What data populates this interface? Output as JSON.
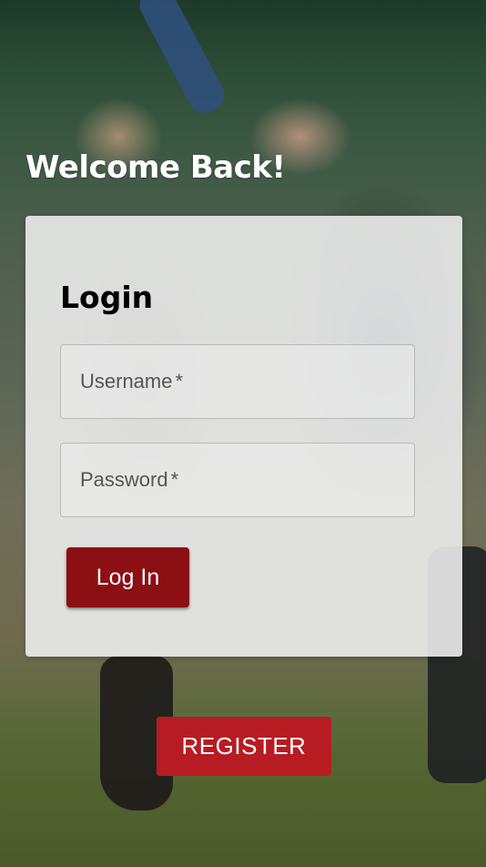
{
  "header": {
    "welcome_text": "Welcome Back!"
  },
  "login_card": {
    "title": "Login",
    "username": {
      "label": "Username",
      "required_mark": "*",
      "value": ""
    },
    "password": {
      "label": "Password",
      "required_mark": "*",
      "value": ""
    },
    "login_button_label": "Log In"
  },
  "register_button_label": "REGISTER",
  "colors": {
    "login_button": "#8c0f14",
    "register_button": "#b71c23",
    "card_background": "#f0f0f0"
  }
}
